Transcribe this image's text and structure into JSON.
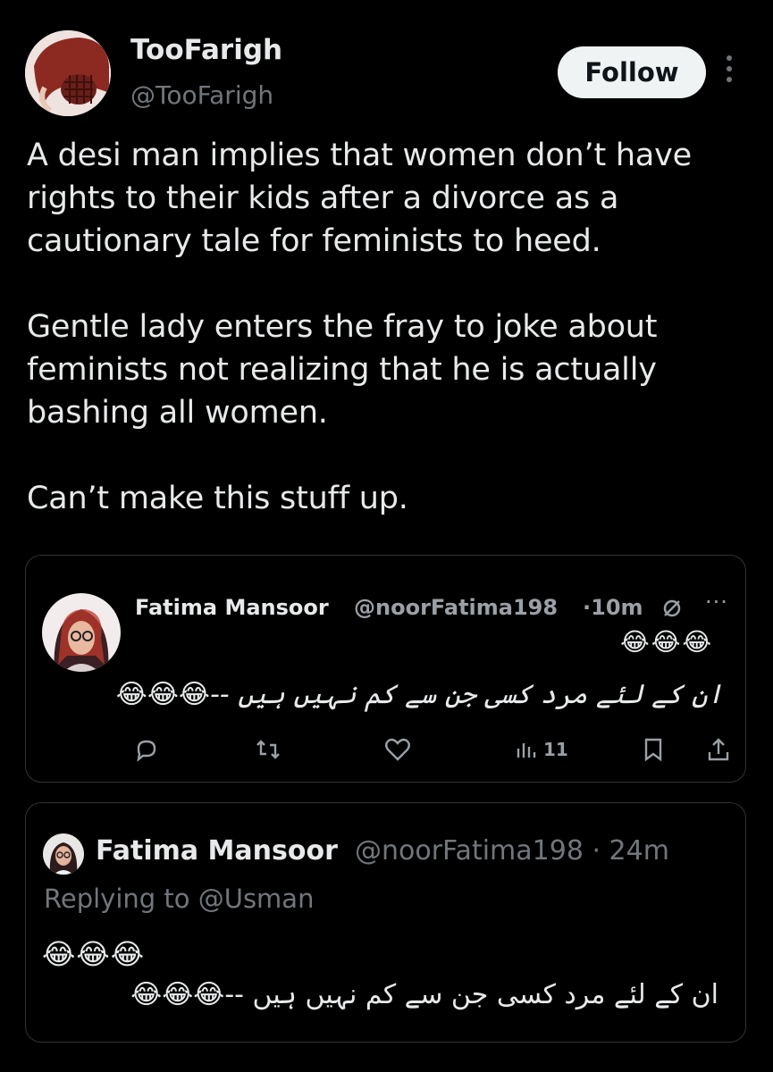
{
  "tweet": {
    "author_name": "TooFarigh",
    "author_handle": "@TooFarigh",
    "follow_label": "Follow",
    "text": "A desi man implies that women don’t have rights to their kids after a divorce as a cautionary tale for feminists to heed.\n\nGentle lady enters the fray to joke about feminists not realizing that he is actually bashing all women.\n\nCan’t make this stuff up."
  },
  "quoted_post": {
    "name": "Fatima Mansoor",
    "handle": "@noorFatima198",
    "time": "·10m",
    "emoji_line": "😂😂😂",
    "urdu_text": "ان کے لئے مرد کسی جن سے کم نہیں ہیں --😂😂😂",
    "views": "11",
    "icons": [
      "circle-slash-icon",
      "more-icon",
      "reply-icon",
      "retweet-icon",
      "like-icon",
      "views-icon",
      "bookmark-icon",
      "share-icon"
    ]
  },
  "reply_post": {
    "name": "Fatima Mansoor",
    "handle": "@noorFatima198 · 24m",
    "replying_prefix": "Replying to",
    "replying_to": "@Usman",
    "emoji_line": "😂😂😂",
    "urdu_text": "ان کے لئے مرد کسی جن سے کم نہیں ہیں --😂😂😂"
  },
  "colors": {
    "background": "#000000",
    "text_primary": "#e7e9ea",
    "text_secondary": "#71767b",
    "follow_bg": "#eff3f4",
    "border": "#2f3336"
  }
}
